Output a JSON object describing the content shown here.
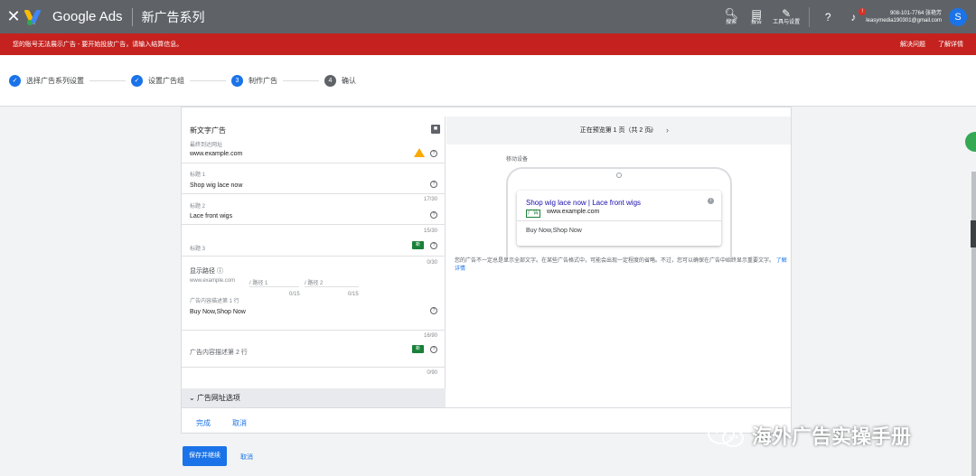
{
  "header": {
    "brand": "Google Ads",
    "campaign_title": "新广告系列",
    "tools": [
      {
        "label": "搜索",
        "icon": "search-icon"
      },
      {
        "label": "报告",
        "icon": "report-icon"
      },
      {
        "label": "工具与设置",
        "icon": "wrench-icon"
      }
    ],
    "notification_count": "!",
    "account_phone": "908-101-7764 张艳芳",
    "account_email": "leasymedia190301@gmail.com",
    "avatar_letter": "S"
  },
  "alert": {
    "message": "您的账号无法展示广告 - 要开始投放广告，请输入结算信息。",
    "fix": "解决问题",
    "learn": "了解详情"
  },
  "stepper": {
    "steps": [
      {
        "label": "选择广告系列设置",
        "state": "done"
      },
      {
        "label": "设置广告组",
        "state": "done"
      },
      {
        "label": "制作广告",
        "state": "current",
        "num": "3"
      },
      {
        "label": "确认",
        "state": "next",
        "num": "4"
      }
    ]
  },
  "form": {
    "section_title": "新文字广告",
    "final_url_label": "最终到达网址",
    "final_url_value": "www.example.com",
    "headline1_label": "标题 1",
    "headline1_value": "Shop wig lace now",
    "headline1_count": "17/30",
    "headline2_label": "标题 2",
    "headline2_value": "Lace front wigs",
    "headline2_count": "15/30",
    "headline3_label": "标题 3",
    "headline3_count": "0/30",
    "new_tag": "新",
    "path_label": "显示路径",
    "path_domain": "www.example.com",
    "path1": "/ 路径 1",
    "path2": "/ 路径 2",
    "path1_count": "0/15",
    "path2_count": "0/15",
    "desc1_label": "广告内容描述第 1 行",
    "desc1_value": "Buy Now,Shop Now",
    "desc1_count": "16/90",
    "desc2_label": "广告内容描述第 2 行",
    "desc2_count": "0/90",
    "url_options": "广告网址选项",
    "done": "完成",
    "cancel": "取消"
  },
  "preview": {
    "pager": "正在预览第 1 页（共 2 页）",
    "device_label": "移动设备",
    "ad_title": "Shop wig lace now | Lace front wigs",
    "ad_tag": "广告",
    "ad_url": "www.example.com",
    "ad_desc": "Buy Now,Shop Now",
    "note": "您的广告不一定总是显示全部文字。在某些广告格式中，可能会出现一定程度的省略。不过，您可以确保在广告中始终显示重要文字。",
    "note_link": "了解详情"
  },
  "footer": {
    "save": "保存并继续",
    "cancel": "取消"
  },
  "watermark": {
    "text": "海外广告实操手册"
  }
}
